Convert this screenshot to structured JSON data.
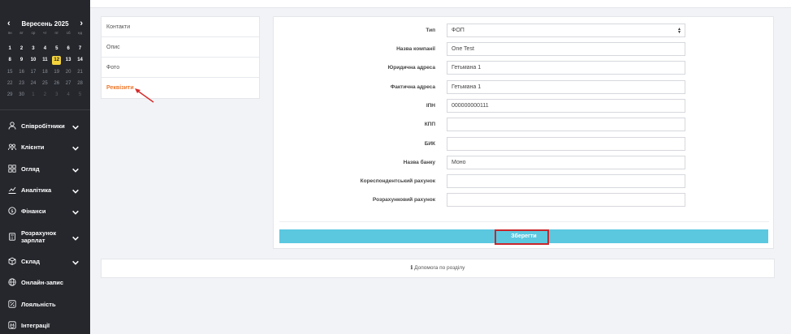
{
  "calendar": {
    "title": "Вересень 2025",
    "prev": "‹",
    "next": "›",
    "weekdays": [
      "пн",
      "вт",
      "ср",
      "чт",
      "пт",
      "сб",
      "нд"
    ],
    "weeks": [
      [
        "1",
        "2",
        "3",
        "4",
        "5",
        "6",
        "7"
      ],
      [
        "8",
        "9",
        "10",
        "11",
        "12",
        "13",
        "14"
      ],
      [
        "15",
        "16",
        "17",
        "18",
        "19",
        "20",
        "21"
      ],
      [
        "22",
        "23",
        "24",
        "25",
        "26",
        "27",
        "28"
      ],
      [
        "29",
        "30",
        "1",
        "2",
        "3",
        "4",
        "5"
      ]
    ],
    "today": "12"
  },
  "sidebar": {
    "items": [
      {
        "label": "Співробітники",
        "icon": "user-icon",
        "chevron": true
      },
      {
        "label": "Клієнти",
        "icon": "clients-icon",
        "chevron": true
      },
      {
        "label": "Огляд",
        "icon": "grid-icon",
        "chevron": true
      },
      {
        "label": "Аналітика",
        "icon": "chart-icon",
        "chevron": true
      },
      {
        "label": "Фінанси",
        "icon": "coin-icon",
        "chevron": true
      },
      {
        "label": "Розрахунок\nзарплат",
        "icon": "calculator-icon",
        "chevron": true
      },
      {
        "label": "Склад",
        "icon": "box-icon",
        "chevron": true
      },
      {
        "label": "Онлайн-запис",
        "icon": "globe-icon",
        "chevron": false
      },
      {
        "label": "Лояльність",
        "icon": "percent-icon",
        "chevron": false
      },
      {
        "label": "Інтеграції",
        "icon": "plug-icon",
        "chevron": false
      }
    ]
  },
  "tabs": {
    "items": [
      "Контакти",
      "Опис",
      "Фото",
      "Реквізити"
    ],
    "active": "Реквізити"
  },
  "form": {
    "type": {
      "label": "Тип",
      "value": "ФОП"
    },
    "company_name": {
      "label": "Назва компанії",
      "value": "One Test"
    },
    "legal_address": {
      "label": "Юридична адреса",
      "value": "Гетьмана 1"
    },
    "actual_address": {
      "label": "Фактична адреса",
      "value": "Гетьмана 1"
    },
    "ipn": {
      "label": "ІПН",
      "value": "000000000111"
    },
    "kpp": {
      "label": "КПП",
      "value": ""
    },
    "bik": {
      "label": "БИК",
      "value": ""
    },
    "bank_name": {
      "label": "Назва банку",
      "value": "Моно"
    },
    "corr_account": {
      "label": "Кореспондентський рахунок",
      "value": ""
    },
    "settlement_account": {
      "label": "Розрахунковий рахунок",
      "value": ""
    },
    "save_label": "Зберегти"
  },
  "help": {
    "label": "Допомога по розділу",
    "icon": "info-icon"
  },
  "colors": {
    "accent": "#ee7a2e",
    "save": "#5bc8e0",
    "highlight": "#c9262b",
    "today": "#f4d33d",
    "sidebar": "#25272d"
  }
}
